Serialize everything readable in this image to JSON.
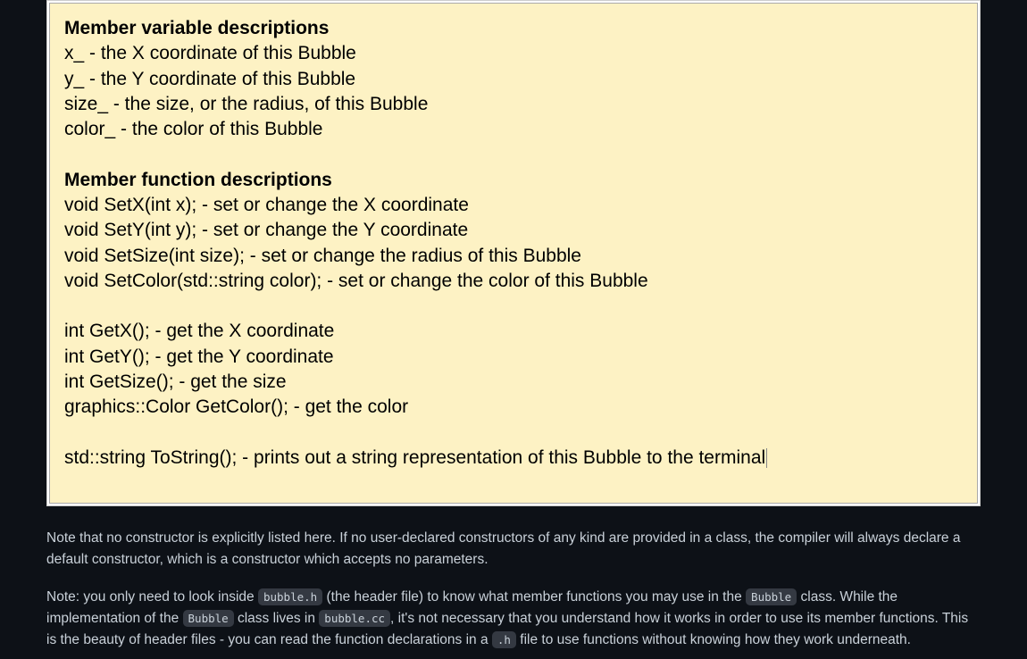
{
  "box": {
    "heading_vars": "Member variable descriptions",
    "vars": [
      "x_ - the X coordinate of this Bubble",
      "y_ - the Y coordinate of this Bubble",
      "size_ - the size, or the radius, of this Bubble",
      "color_ - the color of this Bubble"
    ],
    "heading_funcs": "Member function descriptions",
    "setters": [
      "void SetX(int x); - set or change the X coordinate",
      "void SetY(int y); - set or change the Y coordinate",
      "void SetSize(int size); - set or change the radius of this Bubble",
      "void SetColor(std::string color); - set or change the color of this Bubble"
    ],
    "getters": [
      "int GetX(); - get the X coordinate",
      "int GetY(); - get the Y coordinate",
      "int GetSize(); - get the size",
      "graphics::Color GetColor(); - get the color"
    ],
    "tostring": "std::string ToString(); - prints out a string representation of this Bubble to the terminal"
  },
  "notes": {
    "p1": "Note that no constructor is explicitly listed here. If no user-declared constructors of any kind are provided in a class, the compiler will always declare a default constructor, which is a constructor which accepts no parameters.",
    "p2_a": "Note: you only need to look inside ",
    "p2_code1": "bubble.h",
    "p2_b": " (the header file) to know what member functions you may use in the ",
    "p2_code2": "Bubble",
    "p2_c": " class. While the implementation of the ",
    "p2_code3": "Bubble",
    "p2_d": " class lives in ",
    "p2_code4": "bubble.cc",
    "p2_e": ", it's not necessary that you understand how it works in order to use its member functions. This is the beauty of header files - you can read the function declarations in a ",
    "p2_code5": ".h",
    "p2_f": " file to use functions without knowing how they work underneath."
  }
}
